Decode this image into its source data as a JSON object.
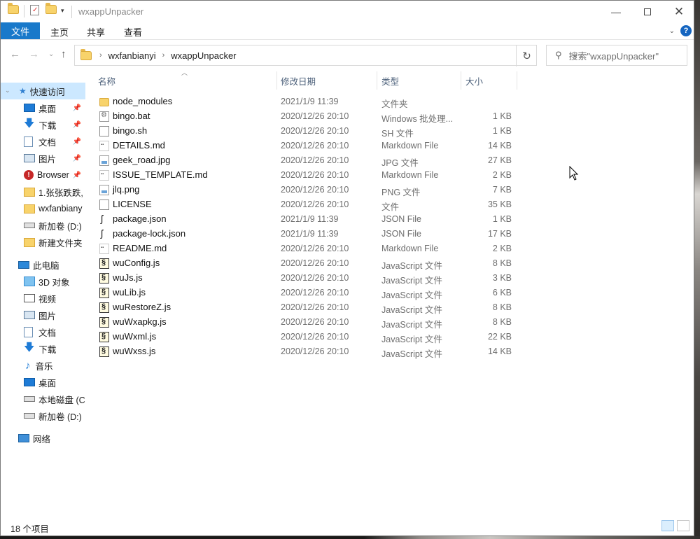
{
  "window": {
    "title": "wxappUnpacker"
  },
  "ribbon": {
    "file_tab": "文件",
    "tabs": [
      "主页",
      "共享",
      "查看"
    ],
    "help": "?"
  },
  "address": {
    "crumbs": [
      "wxfanbianyi",
      "wxappUnpacker"
    ]
  },
  "search": {
    "placeholder": "搜索\"wxappUnpacker\""
  },
  "sidebar": {
    "items": [
      {
        "label": "快速访问",
        "icon": "star-icon",
        "selected": true,
        "pinned": false
      },
      {
        "label": "桌面",
        "icon": "desktop-icon",
        "pinned": true
      },
      {
        "label": "下载",
        "icon": "download-icon",
        "pinned": true
      },
      {
        "label": "文档",
        "icon": "document-icon",
        "pinned": true
      },
      {
        "label": "图片",
        "icon": "picture-icon",
        "pinned": true
      },
      {
        "label": "Browser",
        "icon": "folder-warning-icon",
        "pinned": true
      },
      {
        "label": "1.张张跌跌,",
        "icon": "folder-icon",
        "pinned": false
      },
      {
        "label": "wxfanbiany",
        "icon": "folder-icon",
        "pinned": false
      },
      {
        "label": "新加卷 (D:)",
        "icon": "drive-icon",
        "pinned": false
      },
      {
        "label": "新建文件夹",
        "icon": "folder-icon",
        "pinned": false
      },
      {
        "label": "此电脑",
        "icon": "computer-icon",
        "pinned": false
      },
      {
        "label": "3D 对象",
        "icon": "3d-objects-icon",
        "pinned": false
      },
      {
        "label": "视频",
        "icon": "video-icon",
        "pinned": false
      },
      {
        "label": "图片",
        "icon": "picture-icon",
        "pinned": false
      },
      {
        "label": "文档",
        "icon": "document-icon",
        "pinned": false
      },
      {
        "label": "下载",
        "icon": "download-icon",
        "pinned": false
      },
      {
        "label": "音乐",
        "icon": "music-icon",
        "pinned": false
      },
      {
        "label": "桌面",
        "icon": "desktop-icon",
        "pinned": false
      },
      {
        "label": "本地磁盘 (C",
        "icon": "drive-c-icon",
        "pinned": false
      },
      {
        "label": "新加卷 (D:)",
        "icon": "drive-icon",
        "pinned": false
      },
      {
        "label": "网络",
        "icon": "network-icon",
        "pinned": false
      }
    ]
  },
  "columns": {
    "name": "名称",
    "date": "修改日期",
    "type": "类型",
    "size": "大小"
  },
  "files": [
    {
      "name": "node_modules",
      "date": "2021/1/9 11:39",
      "type": "文件夹",
      "size": "",
      "icon": "folder-icon"
    },
    {
      "name": "bingo.bat",
      "date": "2020/12/26 20:10",
      "type": "Windows 批处理...",
      "size": "1 KB",
      "icon": "batch-file-icon"
    },
    {
      "name": "bingo.sh",
      "date": "2020/12/26 20:10",
      "type": "SH 文件",
      "size": "1 KB",
      "icon": "generic-file-icon"
    },
    {
      "name": "DETAILS.md",
      "date": "2020/12/26 20:10",
      "type": "Markdown File",
      "size": "14 KB",
      "icon": "markdown-file-icon"
    },
    {
      "name": "geek_road.jpg",
      "date": "2020/12/26 20:10",
      "type": "JPG 文件",
      "size": "27 KB",
      "icon": "image-file-icon"
    },
    {
      "name": "ISSUE_TEMPLATE.md",
      "date": "2020/12/26 20:10",
      "type": "Markdown File",
      "size": "2 KB",
      "icon": "markdown-file-icon"
    },
    {
      "name": "jlq.png",
      "date": "2020/12/26 20:10",
      "type": "PNG 文件",
      "size": "7 KB",
      "icon": "image-file-icon"
    },
    {
      "name": "LICENSE",
      "date": "2020/12/26 20:10",
      "type": "文件",
      "size": "35 KB",
      "icon": "generic-file-icon"
    },
    {
      "name": "package.json",
      "date": "2021/1/9 11:39",
      "type": "JSON File",
      "size": "1 KB",
      "icon": "json-file-icon"
    },
    {
      "name": "package-lock.json",
      "date": "2021/1/9 11:39",
      "type": "JSON File",
      "size": "17 KB",
      "icon": "json-file-icon"
    },
    {
      "name": "README.md",
      "date": "2020/12/26 20:10",
      "type": "Markdown File",
      "size": "2 KB",
      "icon": "markdown-file-icon"
    },
    {
      "name": "wuConfig.js",
      "date": "2020/12/26 20:10",
      "type": "JavaScript 文件",
      "size": "8 KB",
      "icon": "js-file-icon"
    },
    {
      "name": "wuJs.js",
      "date": "2020/12/26 20:10",
      "type": "JavaScript 文件",
      "size": "3 KB",
      "icon": "js-file-icon"
    },
    {
      "name": "wuLib.js",
      "date": "2020/12/26 20:10",
      "type": "JavaScript 文件",
      "size": "6 KB",
      "icon": "js-file-icon"
    },
    {
      "name": "wuRestoreZ.js",
      "date": "2020/12/26 20:10",
      "type": "JavaScript 文件",
      "size": "8 KB",
      "icon": "js-file-icon"
    },
    {
      "name": "wuWxapkg.js",
      "date": "2020/12/26 20:10",
      "type": "JavaScript 文件",
      "size": "8 KB",
      "icon": "js-file-icon"
    },
    {
      "name": "wuWxml.js",
      "date": "2020/12/26 20:10",
      "type": "JavaScript 文件",
      "size": "22 KB",
      "icon": "js-file-icon"
    },
    {
      "name": "wuWxss.js",
      "date": "2020/12/26 20:10",
      "type": "JavaScript 文件",
      "size": "14 KB",
      "icon": "js-file-icon"
    }
  ],
  "status": {
    "item_count": "18 个项目"
  },
  "colors": {
    "accent": "#1979ca",
    "selection": "#cce8ff",
    "header_text": "#4c607a"
  }
}
